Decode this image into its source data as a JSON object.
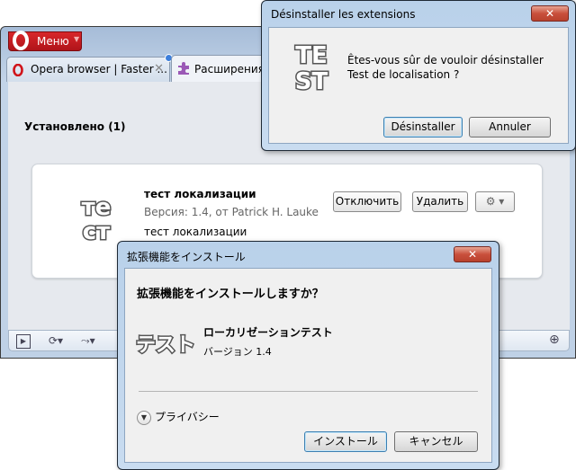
{
  "browser": {
    "menu_label": "Меню",
    "tabs": [
      {
        "label": "Opera browser | Faster ...",
        "icon": "opera-logo-icon",
        "close": "✕"
      },
      {
        "label": "Расширения",
        "icon": "puzzle-piece-icon"
      }
    ],
    "installed_header": "Установлено (1)",
    "extension": {
      "logo_top": "те",
      "logo_bottom": "ст",
      "name": "тест локализации",
      "version": "Версия: 1.4,  от Patrick H. Lauke",
      "description": "тест локализации",
      "disable_label": "Отключить",
      "remove_label": "Удалить",
      "gear_label": "⚙ ▾"
    },
    "bottombar": {
      "panel_icon": "▶",
      "sync_icon": "⟳▾",
      "share_icon": "⤳▾",
      "zoom_icon": "⊕"
    }
  },
  "uninstall_dialog": {
    "title": "Désinstaller les extensions",
    "close": "✕",
    "logo_top": "TE",
    "logo_bottom": "ST",
    "message": "Êtes-vous sûr de vouloir désinstaller Test de localisation ?",
    "confirm_label": "Désinstaller",
    "cancel_label": "Annuler"
  },
  "install_dialog": {
    "title": "拡張機能をインストール",
    "close": "✕",
    "question": "拡張機能をインストールしますか？",
    "logo_text": "テスト",
    "extension_name": "ローカリゼーションテスト",
    "version": "バージョン 1.4",
    "privacy_label": "プライバシー",
    "install_label": "インストール",
    "cancel_label": "キャンセル"
  }
}
